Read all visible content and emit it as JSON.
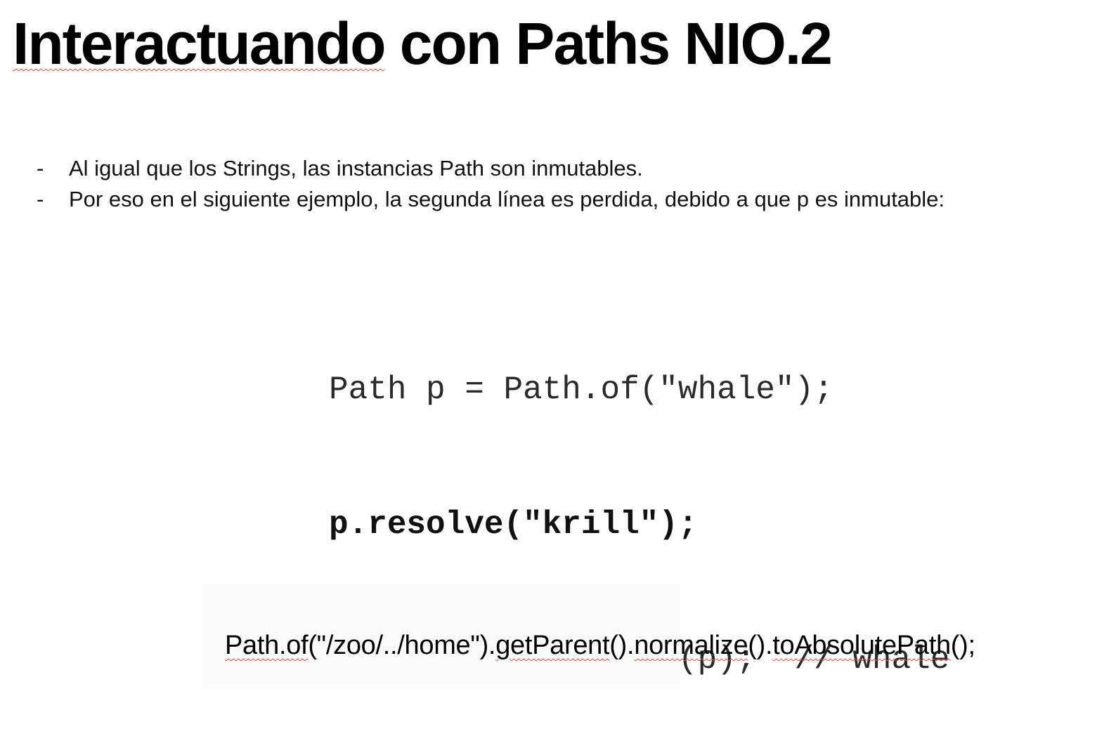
{
  "slide": {
    "title": {
      "underlined": "Interactuando",
      "rest": " con Paths NIO.2"
    },
    "bullets": [
      {
        "marker": "-",
        "text": "Al igual que los Strings, las instancias Path son inmutables."
      },
      {
        "marker": "-",
        "text": "Por eso en el siguiente ejemplo, la segunda línea es perdida, debido a que p es inmutable:"
      }
    ],
    "code_lines": [
      "Path p = Path.of(\"whale\");",
      "p.resolve(\"krill\");",
      "System.out.println(p);  // whale"
    ],
    "bottom_code": {
      "part1": "Path.of",
      "part2": "(\"/zoo/../home\").",
      "part3": "getParent",
      "part4": "().",
      "part5": "normalize",
      "part6": "().",
      "part7": "toAbsolutePath",
      "part8": "();"
    }
  },
  "colors": {
    "spell_underline": "#e04848",
    "background": "#ffffff",
    "text": "#000000"
  }
}
